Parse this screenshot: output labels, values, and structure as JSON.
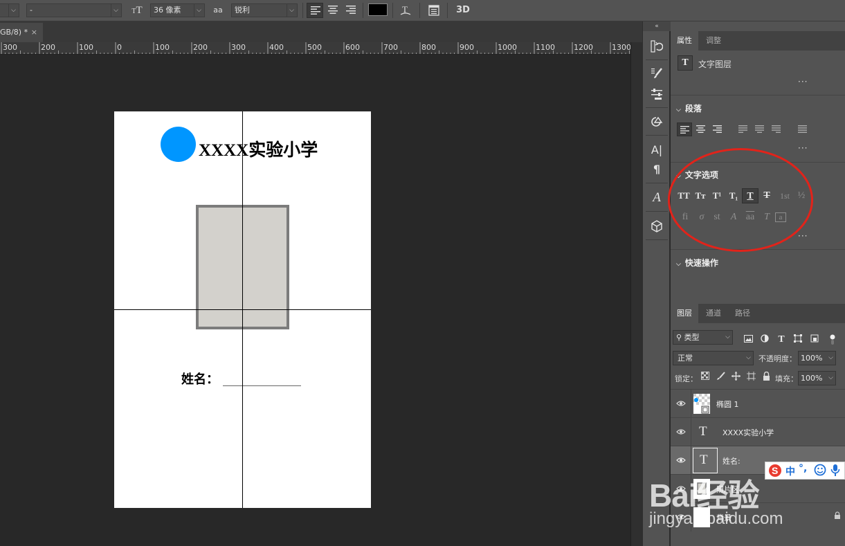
{
  "options_bar": {
    "font_style": "-",
    "font_size": "36 像素",
    "aa_label": "aa",
    "antialias": "锐利",
    "btn_3d": "3D"
  },
  "document_tab": {
    "title": "GB/8) *",
    "close": "×"
  },
  "ruler": {
    "ticks": [
      "300",
      "200",
      "100",
      "0",
      "100",
      "200",
      "300",
      "400",
      "500",
      "600",
      "700",
      "800",
      "900",
      "1000",
      "1100",
      "1200",
      "1300"
    ]
  },
  "canvas": {
    "school_name": "XXXX实验小学",
    "name_label": "姓名：",
    "colors": {
      "circle": "#0096ff",
      "photo_fill": "#d3d1cc",
      "photo_border": "#7c7c7c"
    }
  },
  "properties_panel": {
    "tabs": [
      "属性",
      "调整"
    ],
    "layer_kind_icon": "T",
    "layer_kind": "文字图层",
    "paragraph_title": "段落",
    "text_options_title": "文字选项",
    "text_options_row1": [
      "TT",
      "Tт",
      "T¹",
      "T₁",
      "T",
      "T",
      "1st",
      "½"
    ],
    "text_options_row2": [
      "fi",
      "σ",
      "st",
      "A",
      "aa",
      "T",
      "a"
    ],
    "quick_actions_title": "快速操作",
    "more": "···"
  },
  "layers_panel": {
    "tabs": [
      "图层",
      "通道",
      "路径"
    ],
    "filter_kind": "类型",
    "blend_mode": "正常",
    "opacity_label": "不透明度：",
    "opacity_value": "100%",
    "lock_label": "锁定：",
    "fill_label": "填充：",
    "fill_value": "100%",
    "layers": [
      {
        "name": "椭圆 1",
        "type": "shape"
      },
      {
        "name": "XXXX实验小学",
        "type": "text"
      },
      {
        "name": "姓名:",
        "type": "text",
        "selected": true
      },
      {
        "name": "照片区",
        "type": "shape"
      },
      {
        "name": "背景",
        "type": "background",
        "locked": true
      }
    ]
  },
  "ime": {
    "zh": "中"
  },
  "watermark": {
    "brand": "Bai经验",
    "url": "jingyan.baidu.com"
  }
}
